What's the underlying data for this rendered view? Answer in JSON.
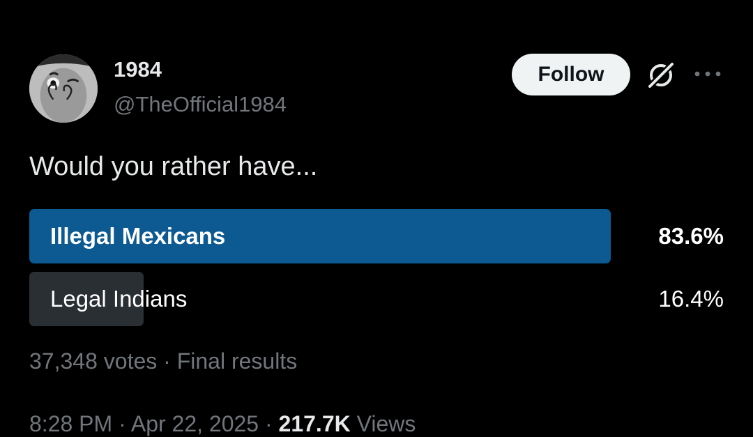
{
  "author": {
    "display_name": "1984",
    "handle": "@TheOfficial1984"
  },
  "actions": {
    "follow_label": "Follow",
    "grok_icon": "grok-icon",
    "more_icon": "more-icon"
  },
  "tweet": {
    "text": "Would you rather have..."
  },
  "poll": {
    "options": [
      {
        "label": "Illegal Mexicans",
        "percent_text": "83.6%",
        "share": 0.836,
        "winner": true,
        "fill_color": "#0c5a91"
      },
      {
        "label": "Legal Indians",
        "percent_text": "16.4%",
        "share": 0.164,
        "winner": false,
        "fill_color": "#2a2f33"
      }
    ],
    "votes": "37,348 votes",
    "separator": "·",
    "status": "Final results"
  },
  "meta": {
    "time": "8:28 PM",
    "separator": "·",
    "date": "Apr 22, 2025",
    "views_count": "217.7K",
    "views_label": "Views"
  },
  "colors": {
    "background": "#000000",
    "primary_text": "#e7e9ea",
    "secondary_text": "#71767b",
    "winner_fill": "#0c5a91",
    "loser_fill": "#2a2f33"
  }
}
